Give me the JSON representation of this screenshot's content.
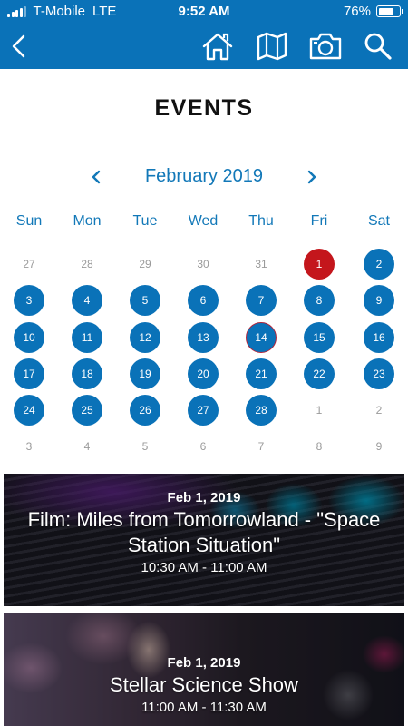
{
  "status_bar": {
    "carrier": "T-Mobile",
    "network": "LTE",
    "time": "9:52 AM",
    "battery": "76%",
    "battery_level": 0.76
  },
  "nav": {
    "back_icon": "chevron-left-icon",
    "home_icon": "home-icon",
    "map_icon": "map-icon",
    "camera_icon": "camera-icon",
    "search_icon": "search-icon"
  },
  "page": {
    "title": "EVENTS"
  },
  "calendar": {
    "month_label": "February 2019",
    "prev_icon": "chevron-left-icon",
    "next_icon": "chevron-right-icon",
    "weekdays": [
      "Sun",
      "Mon",
      "Tue",
      "Wed",
      "Thu",
      "Fri",
      "Sat"
    ],
    "selected_day": "1",
    "today_day": "14",
    "weeks": [
      [
        {
          "d": "27",
          "in": false
        },
        {
          "d": "28",
          "in": false
        },
        {
          "d": "29",
          "in": false
        },
        {
          "d": "30",
          "in": false
        },
        {
          "d": "31",
          "in": false
        },
        {
          "d": "1",
          "in": true
        },
        {
          "d": "2",
          "in": true
        }
      ],
      [
        {
          "d": "3",
          "in": true
        },
        {
          "d": "4",
          "in": true
        },
        {
          "d": "5",
          "in": true
        },
        {
          "d": "6",
          "in": true
        },
        {
          "d": "7",
          "in": true
        },
        {
          "d": "8",
          "in": true
        },
        {
          "d": "9",
          "in": true
        }
      ],
      [
        {
          "d": "10",
          "in": true
        },
        {
          "d": "11",
          "in": true
        },
        {
          "d": "12",
          "in": true
        },
        {
          "d": "13",
          "in": true
        },
        {
          "d": "14",
          "in": true
        },
        {
          "d": "15",
          "in": true
        },
        {
          "d": "16",
          "in": true
        }
      ],
      [
        {
          "d": "17",
          "in": true
        },
        {
          "d": "18",
          "in": true
        },
        {
          "d": "19",
          "in": true
        },
        {
          "d": "20",
          "in": true
        },
        {
          "d": "21",
          "in": true
        },
        {
          "d": "22",
          "in": true
        },
        {
          "d": "23",
          "in": true
        }
      ],
      [
        {
          "d": "24",
          "in": true
        },
        {
          "d": "25",
          "in": true
        },
        {
          "d": "26",
          "in": true
        },
        {
          "d": "27",
          "in": true
        },
        {
          "d": "28",
          "in": true
        },
        {
          "d": "1",
          "in": false
        },
        {
          "d": "2",
          "in": false
        }
      ],
      [
        {
          "d": "3",
          "in": false
        },
        {
          "d": "4",
          "in": false
        },
        {
          "d": "5",
          "in": false
        },
        {
          "d": "6",
          "in": false
        },
        {
          "d": "7",
          "in": false
        },
        {
          "d": "8",
          "in": false
        },
        {
          "d": "9",
          "in": false
        }
      ]
    ]
  },
  "events": [
    {
      "date": "Feb 1, 2019",
      "title": "Film: Miles from Tomorrowland - \"Space Station Situation\"",
      "time": "10:30 AM - 11:00 AM"
    },
    {
      "date": "Feb 1, 2019",
      "title": "Stellar Science Show",
      "time": "11:00 AM - 11:30 AM"
    }
  ],
  "colors": {
    "brand_blue": "#0a72b8",
    "selected_red": "#c4161c",
    "today_ring": "#b0263c",
    "accent_text": "#1278b8"
  }
}
